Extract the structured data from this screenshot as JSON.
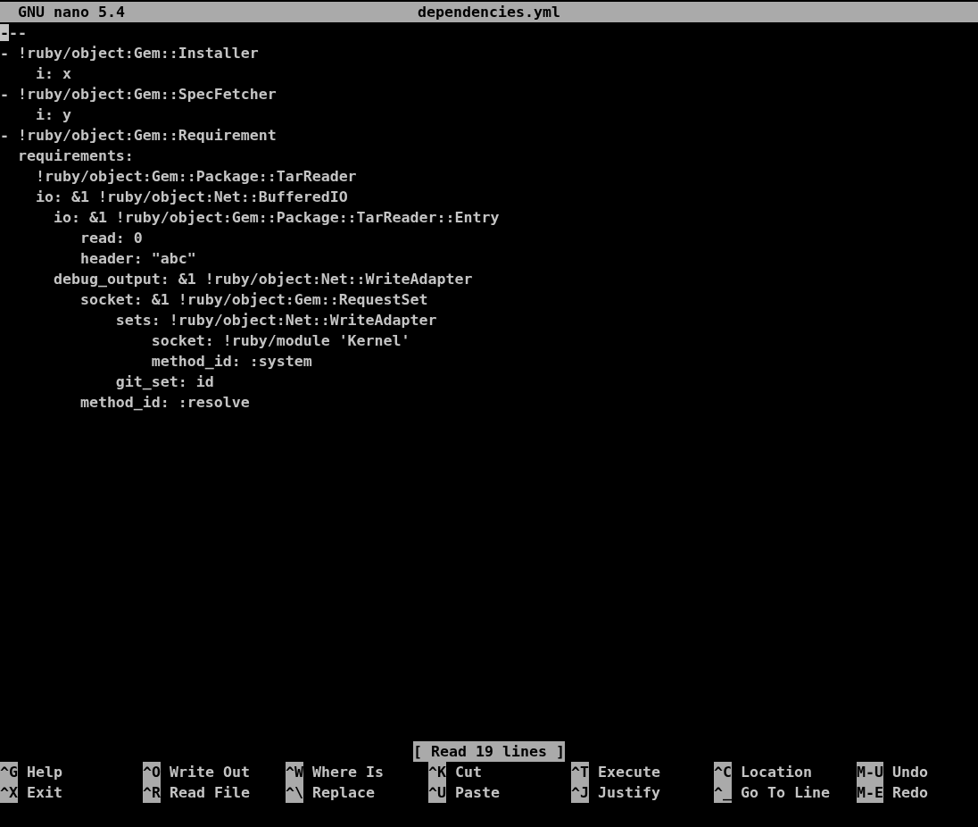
{
  "title_bar": {
    "app": "GNU nano 5.4",
    "filename": "dependencies.yml"
  },
  "editor": {
    "lines": [
      {
        "text": "---",
        "cursor": true
      },
      {
        "text": "- !ruby/object:Gem::Installer",
        "cursor": false
      },
      {
        "text": "    i: x",
        "cursor": false
      },
      {
        "text": "- !ruby/object:Gem::SpecFetcher",
        "cursor": false
      },
      {
        "text": "    i: y",
        "cursor": false
      },
      {
        "text": "- !ruby/object:Gem::Requirement",
        "cursor": false
      },
      {
        "text": "  requirements:",
        "cursor": false
      },
      {
        "text": "    !ruby/object:Gem::Package::TarReader",
        "cursor": false
      },
      {
        "text": "    io: &1 !ruby/object:Net::BufferedIO",
        "cursor": false
      },
      {
        "text": "      io: &1 !ruby/object:Gem::Package::TarReader::Entry",
        "cursor": false
      },
      {
        "text": "         read: 0",
        "cursor": false
      },
      {
        "text": "         header: \"abc\"",
        "cursor": false
      },
      {
        "text": "      debug_output: &1 !ruby/object:Net::WriteAdapter",
        "cursor": false
      },
      {
        "text": "         socket: &1 !ruby/object:Gem::RequestSet",
        "cursor": false
      },
      {
        "text": "             sets: !ruby/object:Net::WriteAdapter",
        "cursor": false
      },
      {
        "text": "                 socket: !ruby/module 'Kernel'",
        "cursor": false
      },
      {
        "text": "                 method_id: :system",
        "cursor": false
      },
      {
        "text": "             git_set: id",
        "cursor": false
      },
      {
        "text": "         method_id: :resolve",
        "cursor": false
      }
    ]
  },
  "status_message": "[ Read 19 lines ]",
  "shortcut_rows": [
    [
      {
        "key": "^G",
        "label": "Help"
      },
      {
        "key": "^O",
        "label": "Write Out"
      },
      {
        "key": "^W",
        "label": "Where Is"
      },
      {
        "key": "^K",
        "label": "Cut"
      },
      {
        "key": "^T",
        "label": "Execute"
      },
      {
        "key": "^C",
        "label": "Location"
      },
      {
        "key": "M-U",
        "label": "Undo"
      }
    ],
    [
      {
        "key": "^X",
        "label": "Exit"
      },
      {
        "key": "^R",
        "label": "Read File"
      },
      {
        "key": "^\\",
        "label": "Replace"
      },
      {
        "key": "^U",
        "label": "Paste"
      },
      {
        "key": "^J",
        "label": "Justify"
      },
      {
        "key": "^_",
        "label": "Go To Line"
      },
      {
        "key": "M-E",
        "label": "Redo"
      }
    ]
  ]
}
